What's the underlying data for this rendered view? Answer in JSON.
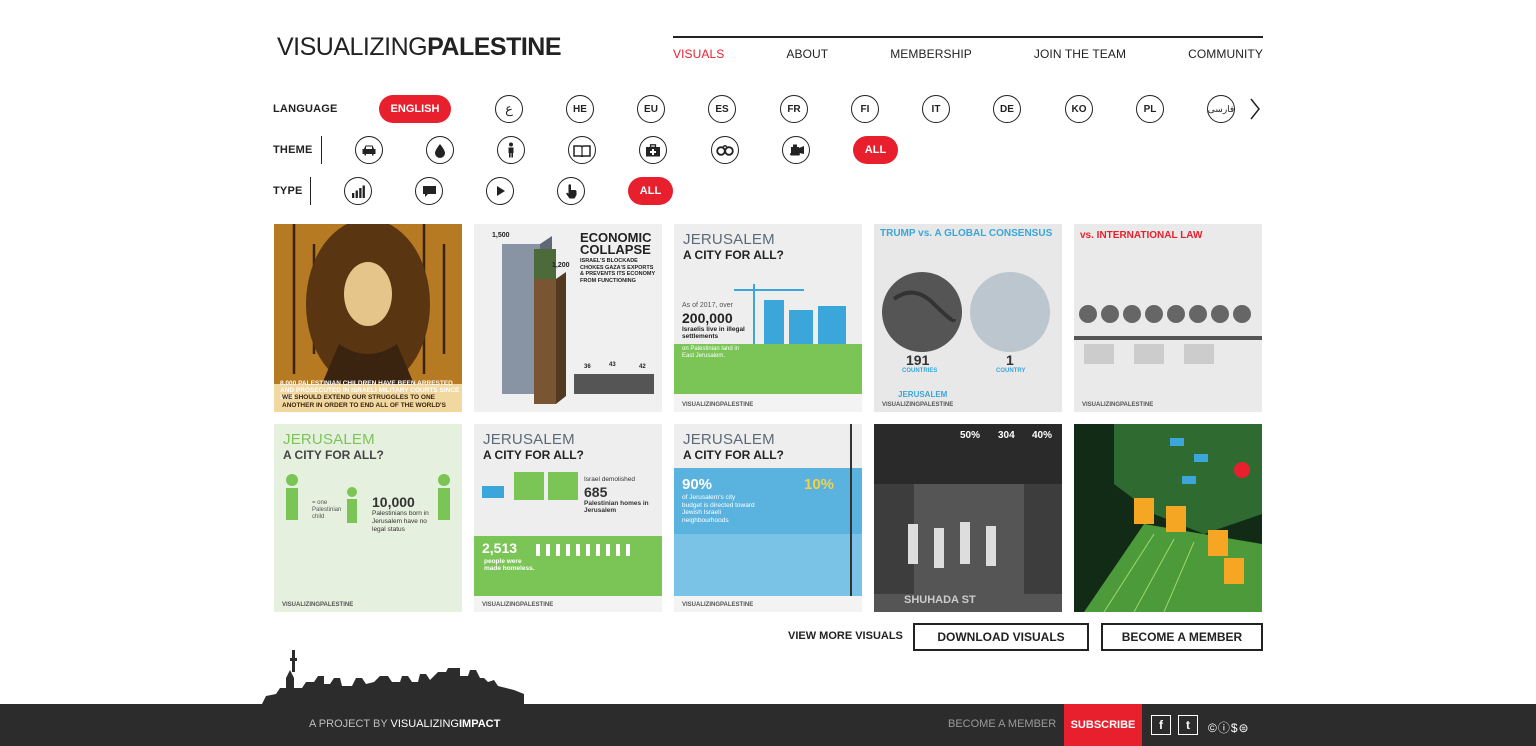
{
  "logo": {
    "part1": "VISUALIZING",
    "part2": "PALESTINE"
  },
  "nav": [
    {
      "label": "VISUALS",
      "active": true
    },
    {
      "label": "ABOUT"
    },
    {
      "label": "MEMBERSHIP"
    },
    {
      "label": "JOIN THE TEAM"
    },
    {
      "label": "COMMUNITY"
    }
  ],
  "filters": {
    "language": {
      "label": "LANGUAGE",
      "selected": "ENGLISH",
      "options": [
        "ع",
        "HE",
        "EU",
        "ES",
        "FR",
        "FI",
        "IT",
        "DE",
        "KO",
        "PL",
        "فارسی"
      ]
    },
    "theme": {
      "label": "THEME",
      "icons": [
        "car-icon",
        "water-drop-icon",
        "person-icon",
        "book-icon",
        "medical-kit-icon",
        "handcuffs-icon",
        "bulldozer-icon"
      ],
      "selected": "ALL"
    },
    "type": {
      "label": "TYPE",
      "icons": [
        "bar-chart-icon",
        "speech-bubble-icon",
        "play-icon",
        "hand-pointer-icon"
      ],
      "selected": "ALL"
    }
  },
  "tiles": [
    {
      "id": "t1",
      "caption": "8,000 PALESTINIAN CHILDREN HAVE BEEN ARRESTED AND PROSECUTED IN ISRAELI MILITARY COURTS SINCE 2000.",
      "quote": "WE SHOULD EXTEND OUR STRUGGLES TO ONE ANOTHER IN ORDER TO END ALL OF THE WORLD'S"
    },
    {
      "id": "t2",
      "title": "ECONOMIC COLLAPSE",
      "sub": "ISRAEL'S BLOCKADE CHOKES GAZA'S EXPORTS & PREVENTS ITS ECONOMY FROM FUNCTIONING",
      "n1": "1,500",
      "n2": "1,200",
      "n3": "36",
      "n4": "43",
      "n5": "42"
    },
    {
      "id": "t3",
      "title": "JERUSALEM",
      "sub": "A CITY FOR ALL?",
      "lead": "As of 2017, over",
      "big": "200,000",
      "body": "Israelis live in illegal settlements",
      "body2": "on Palestinian land in East Jerusalem."
    },
    {
      "id": "t4",
      "title": "TRUMP vs. A GLOBAL CONSENSUS",
      "n1": "191",
      "l1": "COUNTRIES",
      "n2": "1",
      "l2": "COUNTRY",
      "word": "JERUSALEM"
    },
    {
      "id": "t5",
      "title": "vs. INTERNATIONAL LAW"
    },
    {
      "id": "t6",
      "title": "JERUSALEM",
      "sub": "A CITY FOR ALL?",
      "big": "10,000",
      "body": "Palestinians born in Jerusalem have no legal status",
      "small": "= one Palestinian child"
    },
    {
      "id": "t7",
      "title": "JERUSALEM",
      "sub": "A CITY FOR ALL?",
      "lead": "Israel demolished",
      "big": "685",
      "body": "Palestinian homes in Jerusalem",
      "big2": "2,513",
      "body2": "people were made homeless."
    },
    {
      "id": "t8",
      "title": "JERUSALEM",
      "sub": "A CITY FOR ALL?",
      "big": "90%",
      "big2": "10%",
      "body": "of Jerusalem's city budget is directed toward Jewish Israeli neighbourhoods"
    },
    {
      "id": "t9",
      "n1": "50%",
      "n2": "304",
      "n3": "40%",
      "word": "SHUHADA ST"
    },
    {
      "id": "t10"
    }
  ],
  "tile_brand": "VISUALIZINGPALESTINE",
  "actions": {
    "view_more": "VIEW MORE VISUALS",
    "download": "DOWNLOAD VISUALS",
    "become_member": "BECOME A MEMBER"
  },
  "footer": {
    "project_prefix": "A PROJECT BY",
    "project_name_1": "VISUALIZING",
    "project_name_2": "IMPACT",
    "member": "BECOME A MEMBER",
    "subscribe": "SUBSCRIBE",
    "facebook": "f",
    "twitter": "t",
    "cc": "©ⓘ$⊜"
  },
  "colors": {
    "accent": "#e8202e",
    "green": "#7bc557",
    "dark": "#2c2c2c"
  }
}
